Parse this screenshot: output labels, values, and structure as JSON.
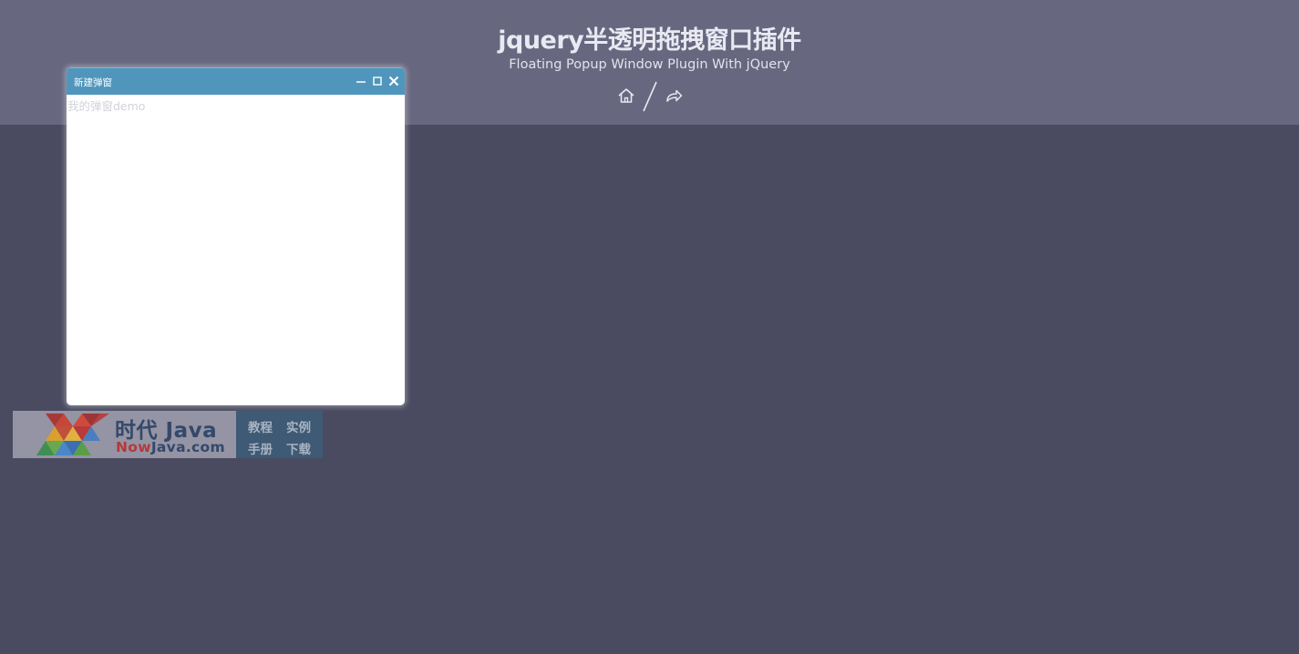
{
  "header": {
    "title": "jquery半透明拖拽窗口插件",
    "subtitle": "Floating Popup Window Plugin With jQuery",
    "nav": {
      "home_icon": "home-icon",
      "share_icon": "share-arrow-icon"
    }
  },
  "popup": {
    "title": "新建弹窗",
    "content": "我的弹窗demo",
    "controls": {
      "minimize_icon": "minimize-icon",
      "maximize_icon": "maximize-icon",
      "close_icon": "close-icon"
    }
  },
  "banner": {
    "name": "时代 Java",
    "domain_accent": "Now",
    "domain_rest": "Java.com",
    "links": [
      "教程",
      "实例",
      "手册",
      "下载"
    ]
  },
  "colors": {
    "page_background": "#4a4a60",
    "header_background": "#676780",
    "titlebar": "#5096bc",
    "banner_dark": "#3e5a74"
  }
}
